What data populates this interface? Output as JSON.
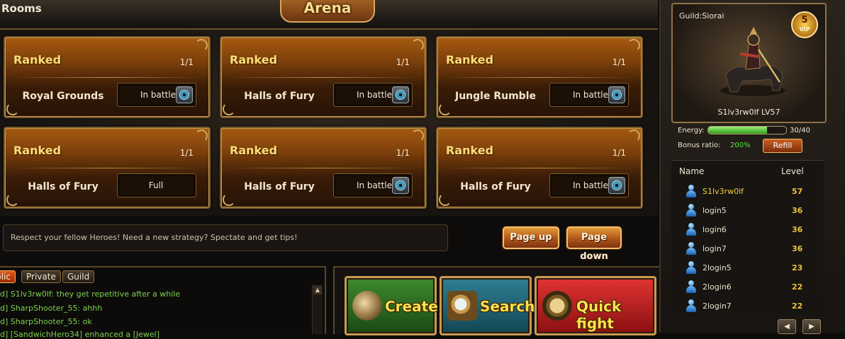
{
  "header": {
    "title": "Rooms",
    "banner": "Arena"
  },
  "rooms": [
    {
      "mode": "Ranked",
      "count": "1/1",
      "name": "Royal Grounds",
      "status": "In battle",
      "spectate": true
    },
    {
      "mode": "Ranked",
      "count": "1/1",
      "name": "Halls of Fury",
      "status": "In battle",
      "spectate": true
    },
    {
      "mode": "Ranked",
      "count": "1/1",
      "name": "Jungle Rumble",
      "status": "In battle",
      "spectate": true
    },
    {
      "mode": "Ranked",
      "count": "1/1",
      "name": "Halls of Fury",
      "status": "Full",
      "spectate": false
    },
    {
      "mode": "Ranked",
      "count": "1/1",
      "name": "Halls of Fury",
      "status": "In battle",
      "spectate": true
    },
    {
      "mode": "Ranked",
      "count": "1/1",
      "name": "Halls of Fury",
      "status": "In battle",
      "spectate": true
    }
  ],
  "notice": "Respect your fellow Heroes! Need a new strategy? Spectate and get tips!",
  "paging": {
    "page_up": "Page up",
    "page_down": "Page down"
  },
  "chat": {
    "tabs": [
      "blic",
      "Private",
      "Guild"
    ],
    "lines": [
      "d] S1lv3rw0lf: they get repetitive after a while",
      "d] SharpShooter_55: ahhh",
      "d] SharpShooter_55: ok",
      "d] [SandwichHero34] enhanced a [Jewel]"
    ]
  },
  "actions": {
    "create": "Create",
    "search": "Search",
    "quick_fight": "Quick fight"
  },
  "profile": {
    "guild": "Guild:Siorai",
    "vip_level": "5",
    "vip_label": "VIP",
    "player": "S1lv3rw0lf   LV57",
    "energy_label": "Energy:",
    "energy_value": "30/40",
    "energy_fraction": 0.75,
    "bonus_label": "Bonus ratio:",
    "bonus_value": "200%",
    "refill": "Refill"
  },
  "members": {
    "col_name": "Name",
    "col_level": "Level",
    "rows": [
      {
        "name": "S1lv3rw0lf",
        "level": "57"
      },
      {
        "name": "login5",
        "level": "36"
      },
      {
        "name": "login6",
        "level": "36"
      },
      {
        "name": "login7",
        "level": "36"
      },
      {
        "name": "2login5",
        "level": "23"
      },
      {
        "name": "2login6",
        "level": "22"
      },
      {
        "name": "2login7",
        "level": "22"
      }
    ]
  },
  "icons": {
    "spectate": "eye-icon",
    "create": "sword-shield-icon",
    "search": "magnifier-scroll-icon",
    "quick_fight": "fist-medallion-icon",
    "member": "person-icon",
    "prev": "arrow-left-icon",
    "next": "arrow-right-icon"
  }
}
